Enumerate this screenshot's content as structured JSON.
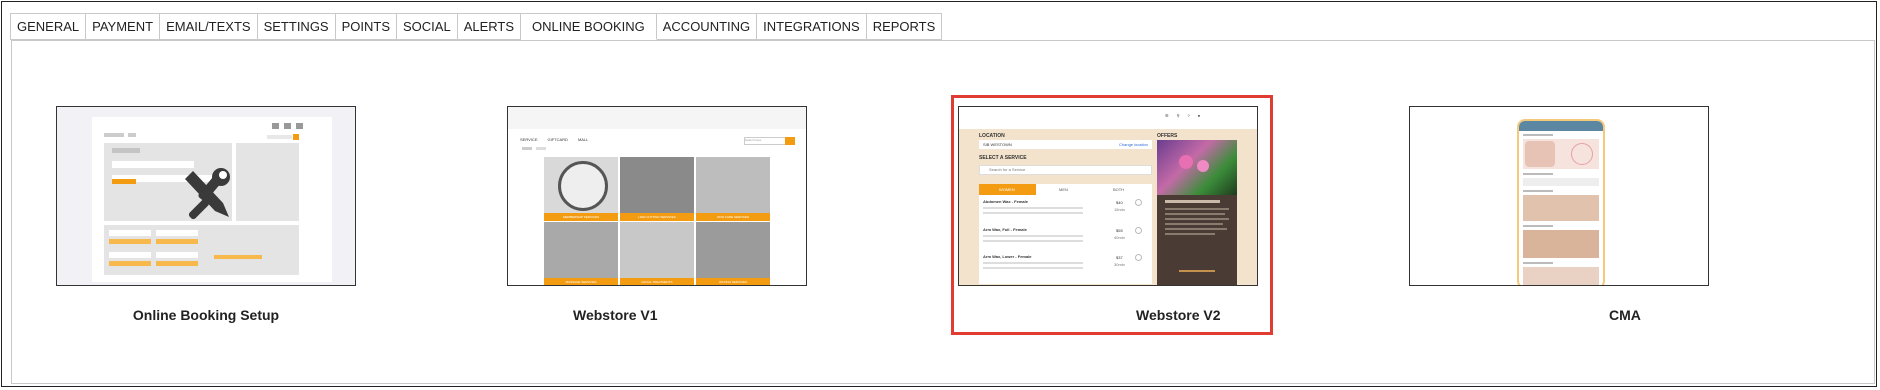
{
  "tabs": [
    {
      "label": "GENERAL"
    },
    {
      "label": "PAYMENT"
    },
    {
      "label": "EMAIL/TEXTS"
    },
    {
      "label": "SETTINGS"
    },
    {
      "label": "POINTS"
    },
    {
      "label": "SOCIAL"
    },
    {
      "label": "ALERTS"
    },
    {
      "label": "ONLINE BOOKING"
    },
    {
      "label": "ACCOUNTING"
    },
    {
      "label": "INTEGRATIONS"
    },
    {
      "label": "REPORTS"
    }
  ],
  "active_tab": "ONLINE BOOKING",
  "cards": [
    {
      "label": "Online Booking Setup"
    },
    {
      "label": "Webstore V1"
    },
    {
      "label": "Webstore V2"
    },
    {
      "label": "CMA"
    }
  ],
  "selected_card": "Webstore V2",
  "colors": {
    "accent_orange": "#f39c12",
    "selected_border": "#e03c31"
  },
  "webstore_v1": {
    "nav": [
      "SERVICE",
      "GIFTCARD",
      "MALL"
    ],
    "search_placeholder": "Search here",
    "tiles": [
      "MEMBERSHIP SERVICES",
      "HAIR CUTTING SERVICES",
      "SKIN CARE SERVICES",
      "MASSAGE SERVICES",
      "FACIAL TREATMENTS",
      "WAXING SERVICES"
    ]
  },
  "webstore_v2": {
    "top_icons": [
      "services",
      "find us",
      "faq",
      "sign in"
    ],
    "location_label": "LOCATION",
    "offers_label": "OFFERS",
    "location_value": "SIB WESTOWN",
    "change_location": "Change location",
    "select_service": "SELECT A SERVICE",
    "search_placeholder": "Search for a Service",
    "segments": [
      "WOMEN",
      "MEN",
      "BOTH"
    ],
    "services": [
      {
        "name": "Abdomen Wax - Female",
        "price": "$40",
        "duration": "15min"
      },
      {
        "name": "Arm Wax, Full - Female",
        "price": "$55",
        "duration": "40min"
      },
      {
        "name": "Arm Wax, Lower - Female",
        "price": "$37",
        "duration": "30min"
      }
    ]
  }
}
